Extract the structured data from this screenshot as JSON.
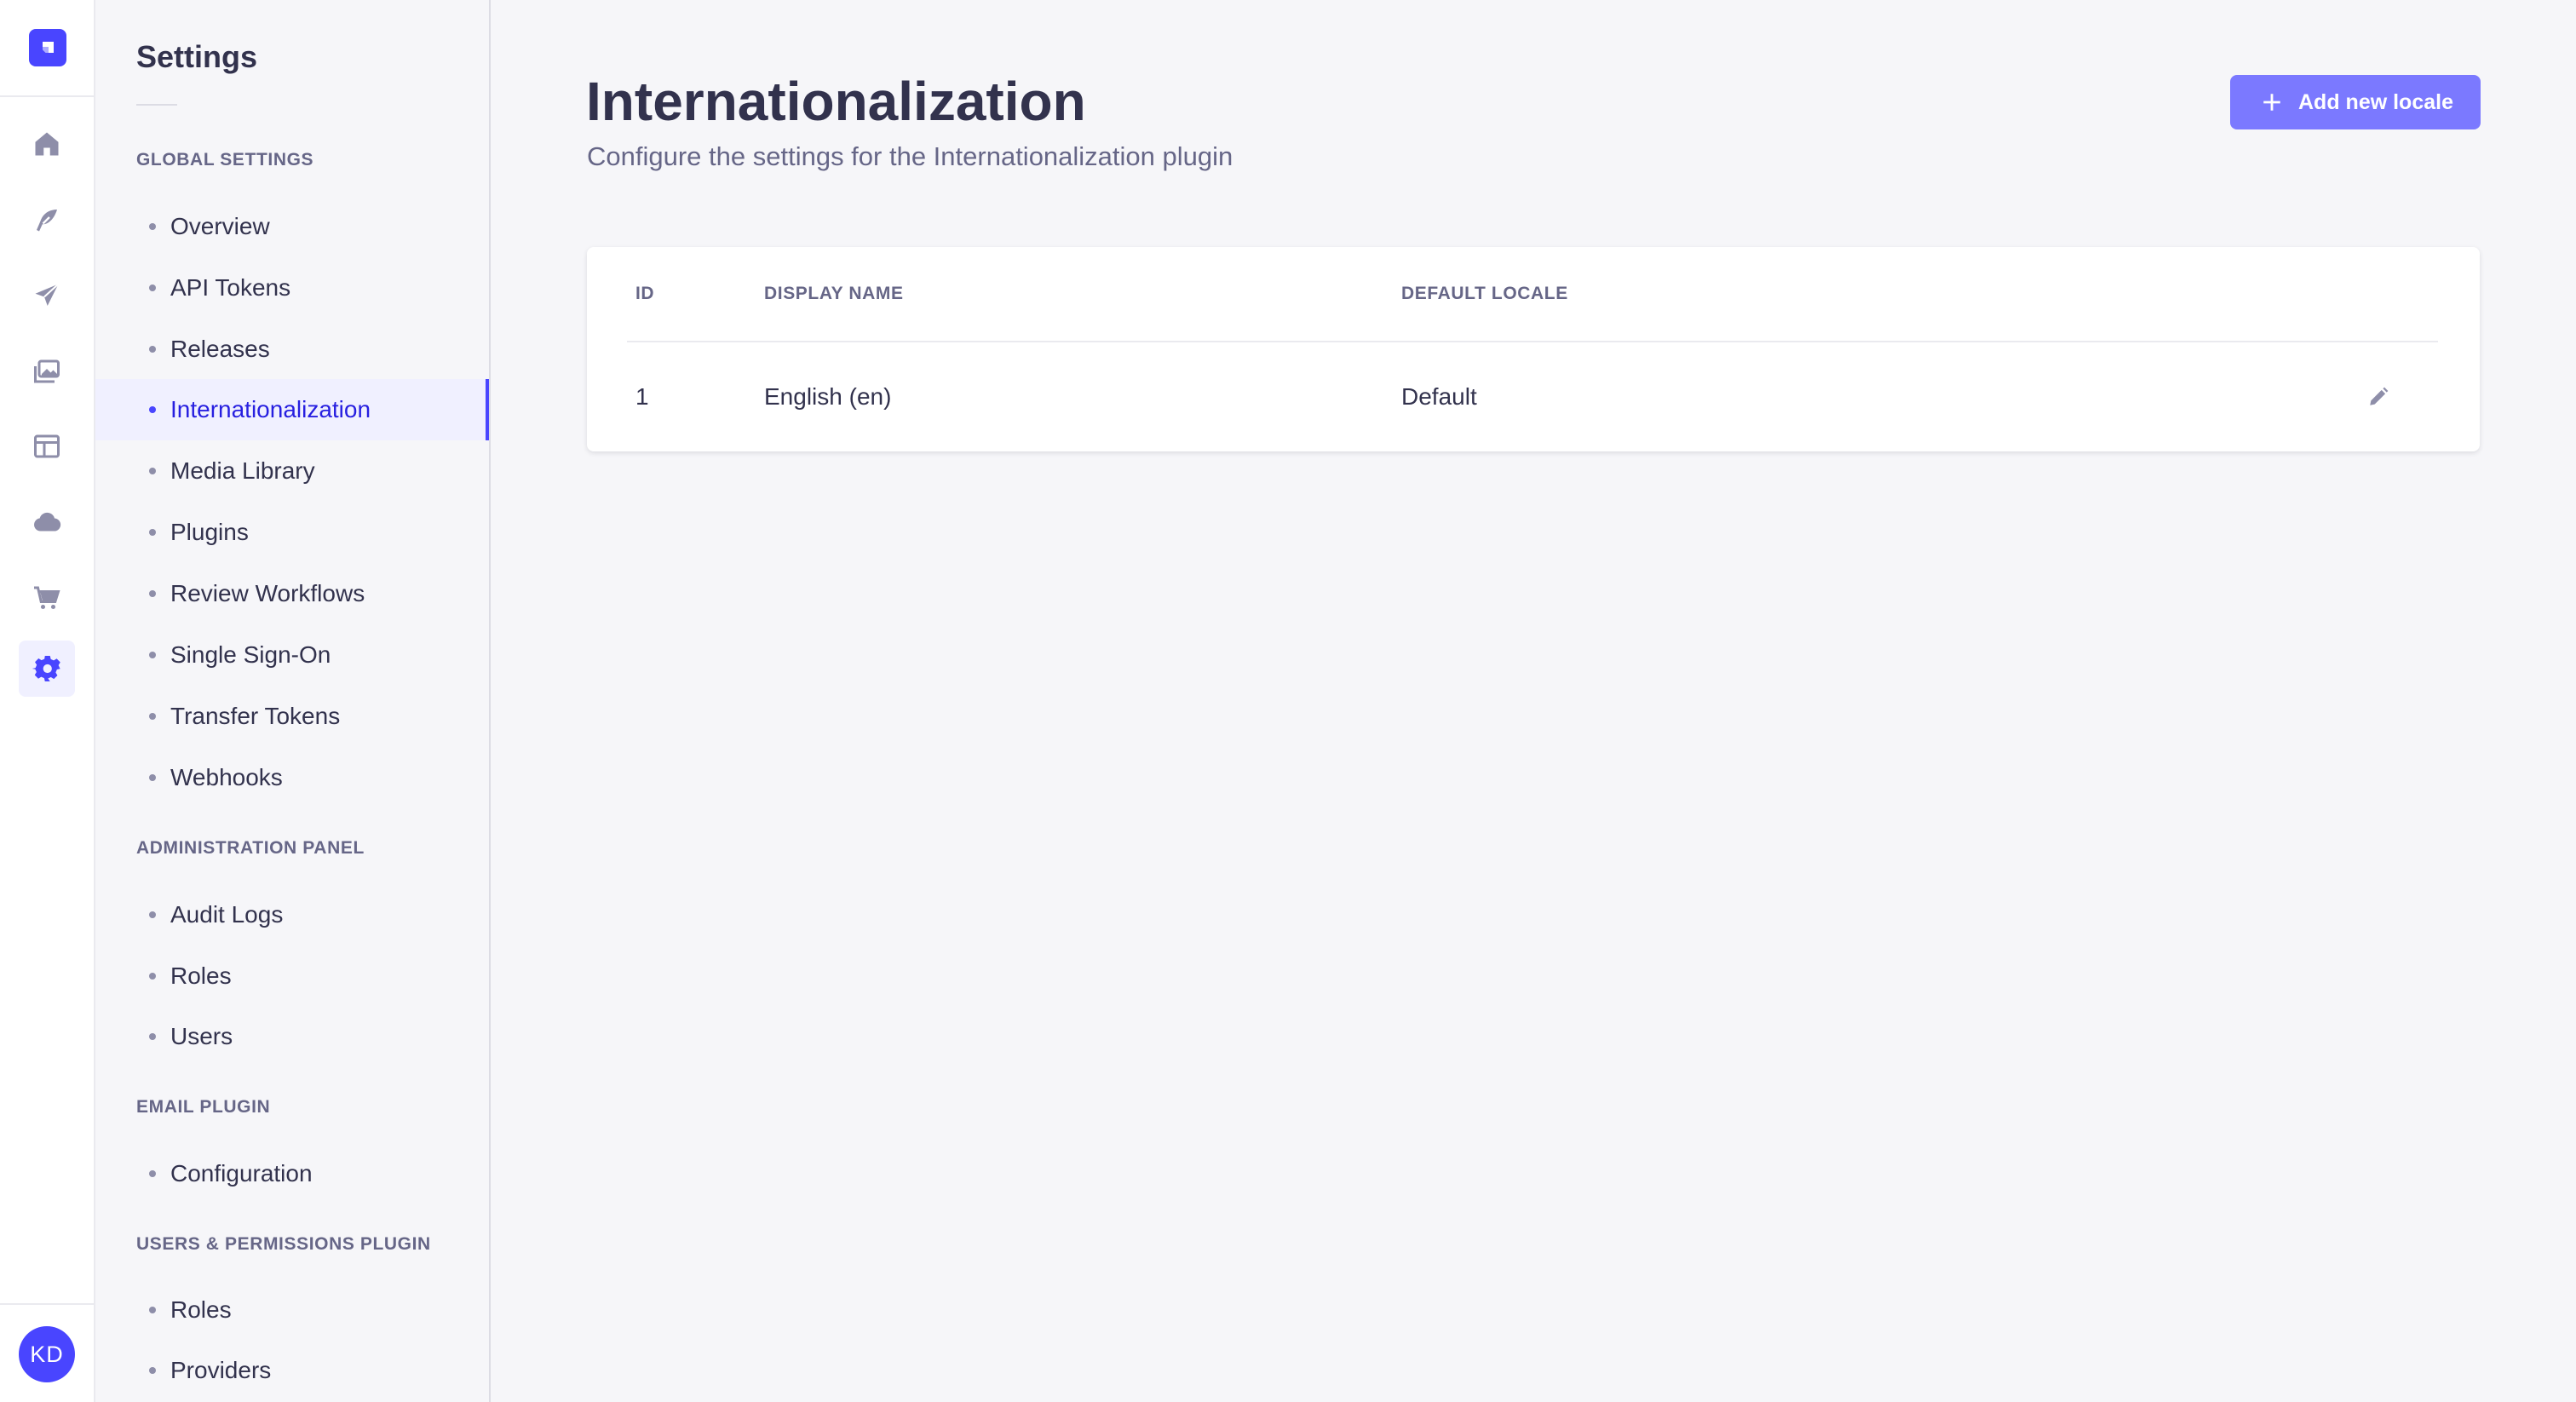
{
  "rail": {
    "user_initials": "KD",
    "items": [
      {
        "icon": "home-icon"
      },
      {
        "icon": "feather-icon"
      },
      {
        "icon": "paper-plane-icon"
      },
      {
        "icon": "images-icon"
      },
      {
        "icon": "layout-icon"
      },
      {
        "icon": "cloud-icon"
      },
      {
        "icon": "shopping-cart-icon"
      },
      {
        "icon": "gear-icon",
        "active": true
      }
    ]
  },
  "subnav": {
    "title": "Settings",
    "sections": [
      {
        "title": "Global Settings",
        "items": [
          "Overview",
          "API Tokens",
          "Releases",
          "Internationalization",
          "Media Library",
          "Plugins",
          "Review Workflows",
          "Single Sign-On",
          "Transfer Tokens",
          "Webhooks"
        ]
      },
      {
        "title": "Administration Panel",
        "items": [
          "Audit Logs",
          "Roles",
          "Users"
        ]
      },
      {
        "title": "Email Plugin",
        "items": [
          "Configuration"
        ]
      },
      {
        "title": "Users & Permissions Plugin",
        "items": [
          "Roles",
          "Providers"
        ]
      }
    ],
    "active_item": "Internationalization"
  },
  "main": {
    "title": "Internationalization",
    "subtitle": "Configure the settings for the Internationalization plugin",
    "add_button_label": "Add new locale",
    "table": {
      "columns": [
        "ID",
        "Display name",
        "Default locale"
      ],
      "rows": [
        {
          "id": "1",
          "display_name": "English (en)",
          "default_locale": "Default"
        }
      ]
    }
  },
  "colors": {
    "accent": "#4945ff",
    "button": "#7b79ff",
    "active_bg": "#f0f0ff",
    "text": "#32324d",
    "muted": "#666687"
  }
}
